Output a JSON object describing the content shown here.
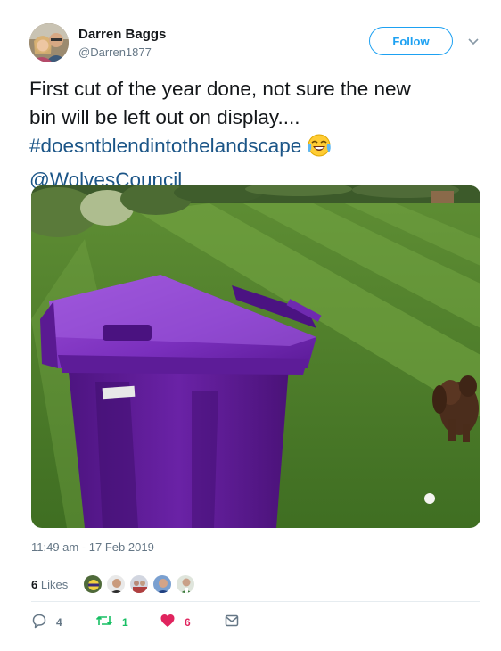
{
  "user": {
    "name": "Darren Baggs",
    "handle": "@Darren1877",
    "follow_label": "Follow"
  },
  "tweet": {
    "line1": "First cut of the year done, not sure the new",
    "line2": "bin will be left out on display....",
    "hashtag": "#doesntblendintothelandscape",
    "emoji": "face-with-tears-of-joy-icon",
    "mention": "@WolvesCouncil"
  },
  "timestamp": "11:49 am - 17 Feb 2019",
  "likes": {
    "count": "6",
    "label": " Likes",
    "avatar_count": 5
  },
  "actions": {
    "replies": "4",
    "retweets": "1",
    "likes": "6"
  },
  "colors": {
    "link": "#1b5587",
    "follow_blue": "#1da1f2",
    "retweet_green": "#17bf63",
    "like_red": "#e0245e",
    "muted": "#657786",
    "bin_purple": "#6a1fa0"
  }
}
